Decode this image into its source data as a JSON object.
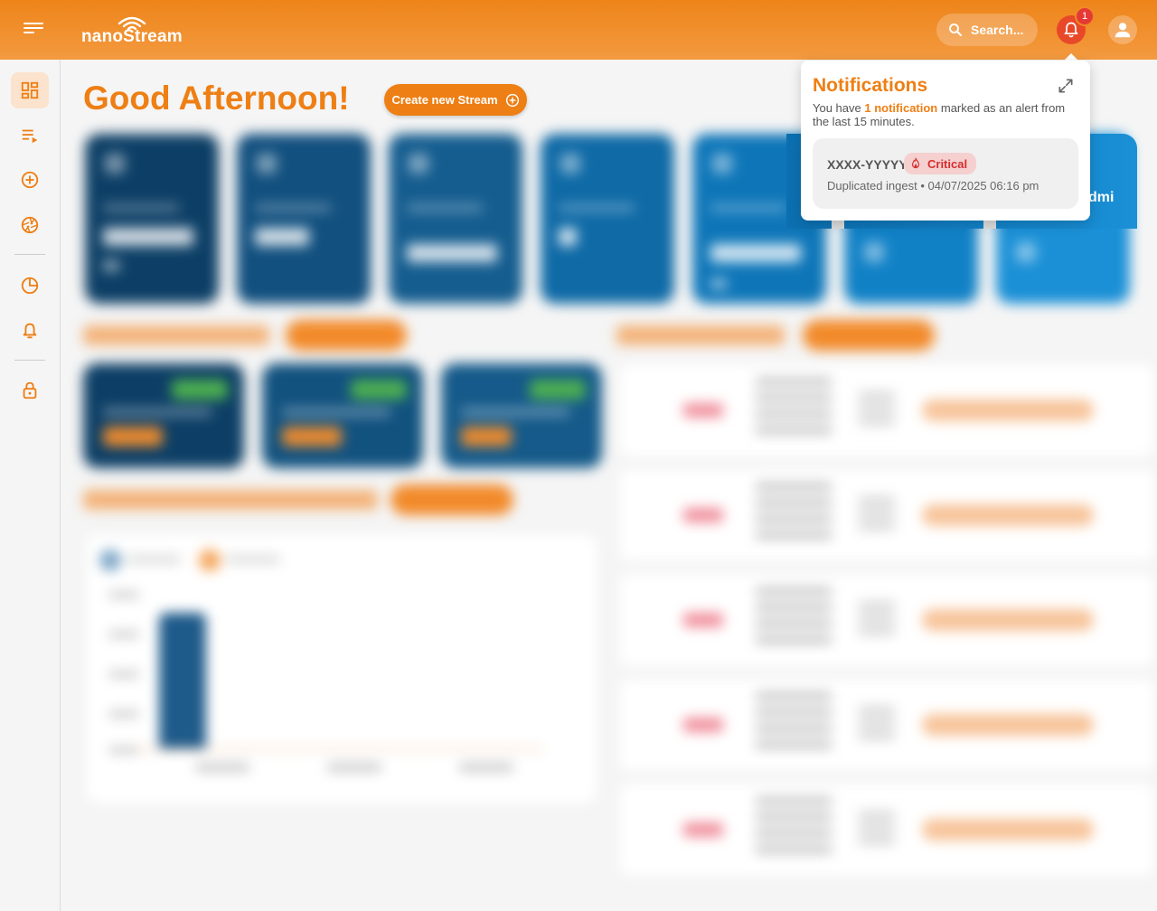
{
  "header": {
    "brand": "nanoStream",
    "search_placeholder": "Search...",
    "notification_count": "1"
  },
  "sidebar": {
    "items": [
      {
        "name": "dashboard",
        "icon": "dashboard-icon"
      },
      {
        "name": "stream-list",
        "icon": "playlist-icon"
      },
      {
        "name": "create",
        "icon": "add-circle-icon"
      },
      {
        "name": "broadcast",
        "icon": "shutter-icon"
      },
      {
        "name": "analytics",
        "icon": "pie-chart-icon"
      },
      {
        "name": "alerts",
        "icon": "bell-icon"
      },
      {
        "name": "security",
        "icon": "lock-icon"
      }
    ]
  },
  "main": {
    "greeting": "Good Afternoon!",
    "create_button": "Create new Stream"
  },
  "notifications": {
    "title": "Notifications",
    "summary_prefix": "You have ",
    "summary_highlight": "1 notification",
    "summary_suffix": " marked as an alert from the last 15 minutes.",
    "items": [
      {
        "id": "XXXX-YYYYY",
        "severity": "Critical",
        "description": "Duplicated ingest • 04/07/2025 06:16 pm"
      }
    ],
    "partial_text_behind": "dmi"
  },
  "colors": {
    "brand_orange": "#ee7f14",
    "critical_red": "#d32f2f",
    "card_blue_dark": "#0d3f66",
    "card_blue_light": "#1b90d6"
  }
}
